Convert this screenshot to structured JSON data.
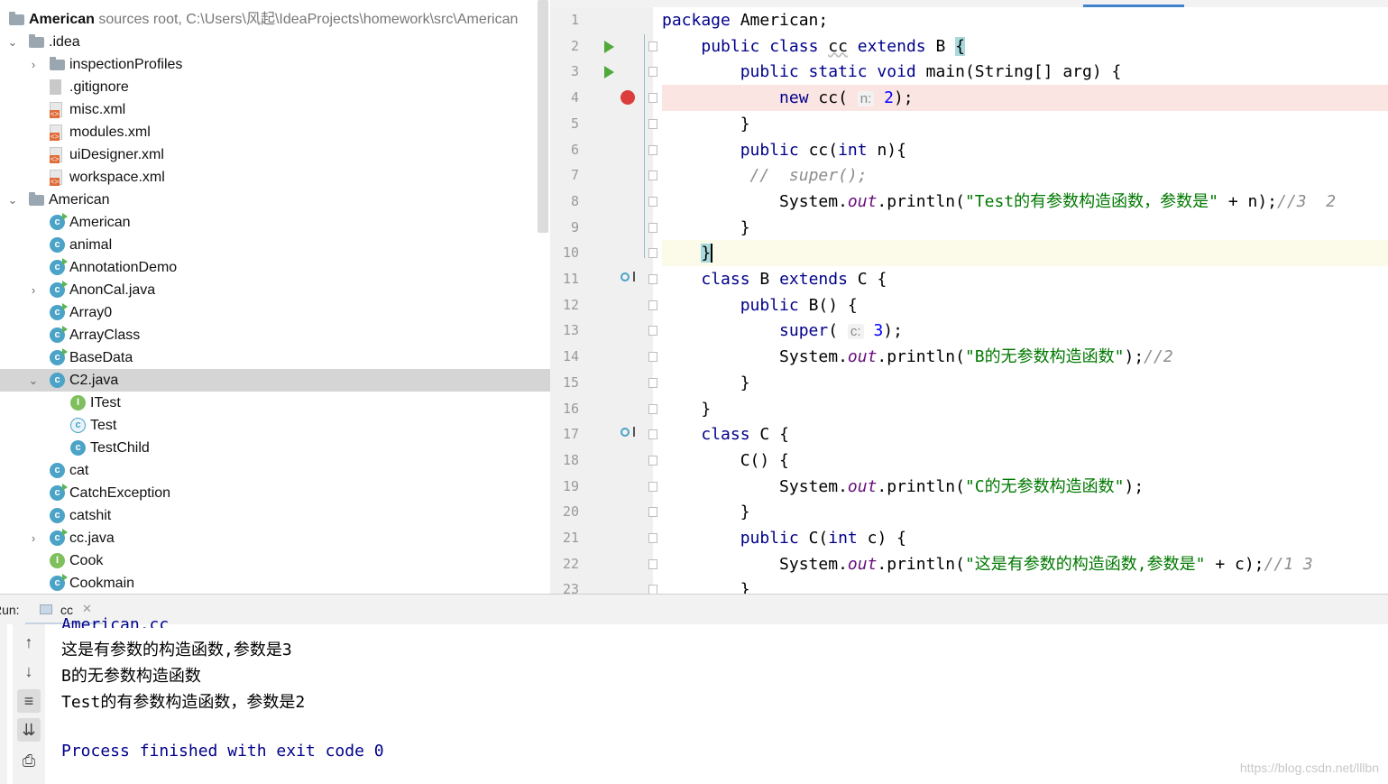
{
  "project_tree": {
    "root": {
      "name": "American",
      "detail": "sources root,  C:\\Users\\风起\\IdeaProjects\\homework\\src\\American"
    },
    "items": [
      {
        "label": ".idea",
        "kind": "folder",
        "depth": 0,
        "expanded": true
      },
      {
        "label": "inspectionProfiles",
        "kind": "folder",
        "depth": 1,
        "expanded": false
      },
      {
        "label": ".gitignore",
        "kind": "file",
        "depth": 1
      },
      {
        "label": "misc.xml",
        "kind": "xml",
        "depth": 1
      },
      {
        "label": "modules.xml",
        "kind": "xml",
        "depth": 1
      },
      {
        "label": "uiDesigner.xml",
        "kind": "xml",
        "depth": 1
      },
      {
        "label": "workspace.xml",
        "kind": "xml",
        "depth": 1
      },
      {
        "label": "American",
        "kind": "folder",
        "depth": 0,
        "expanded": true
      },
      {
        "label": "American",
        "kind": "class-main",
        "depth": 1
      },
      {
        "label": "animal",
        "kind": "class",
        "depth": 1
      },
      {
        "label": "AnnotationDemo",
        "kind": "class-main",
        "depth": 1
      },
      {
        "label": "AnonCal.java",
        "kind": "class-main",
        "depth": 1,
        "expanded": false
      },
      {
        "label": "Array0",
        "kind": "class-main",
        "depth": 1
      },
      {
        "label": "ArrayClass",
        "kind": "class-main",
        "depth": 1
      },
      {
        "label": "BaseData",
        "kind": "class-main",
        "depth": 1
      },
      {
        "label": "C2.java",
        "kind": "class",
        "depth": 1,
        "expanded": true,
        "selected": true
      },
      {
        "label": "ITest",
        "kind": "interface",
        "depth": 2
      },
      {
        "label": "Test",
        "kind": "class-outline",
        "depth": 2
      },
      {
        "label": "TestChild",
        "kind": "class",
        "depth": 2
      },
      {
        "label": "cat",
        "kind": "class",
        "depth": 1
      },
      {
        "label": "CatchException",
        "kind": "class-main",
        "depth": 1
      },
      {
        "label": "catshit",
        "kind": "class",
        "depth": 1
      },
      {
        "label": "cc.java",
        "kind": "class-main",
        "depth": 1,
        "expanded": false
      },
      {
        "label": "Cook",
        "kind": "interface",
        "depth": 1
      },
      {
        "label": "Cookmain",
        "kind": "class-main",
        "depth": 1
      }
    ]
  },
  "editor": {
    "lines": [
      {
        "n": "1",
        "parts": [
          [
            "kw",
            "package"
          ],
          [
            "t",
            " American;"
          ]
        ]
      },
      {
        "n": "2",
        "gutter": "run",
        "parts": [
          [
            "t",
            "    "
          ],
          [
            "kw",
            "public class "
          ],
          [
            "sq",
            "cc"
          ],
          [
            "kw",
            " extends "
          ],
          [
            "t",
            "B "
          ],
          [
            "bh",
            "{"
          ]
        ]
      },
      {
        "n": "3",
        "gutter": "run",
        "parts": [
          [
            "t",
            "        "
          ],
          [
            "kw",
            "public static void "
          ],
          [
            "t",
            "main(String[] arg) {"
          ]
        ]
      },
      {
        "n": "4",
        "gutter": "breakpoint",
        "highlight": "red",
        "parts": [
          [
            "t",
            "            "
          ],
          [
            "kw",
            "new "
          ],
          [
            "t",
            "cc( "
          ],
          [
            "hint",
            "n:"
          ],
          [
            "t",
            " "
          ],
          [
            "num",
            "2"
          ],
          [
            "t",
            ");"
          ]
        ]
      },
      {
        "n": "5",
        "parts": [
          [
            "t",
            "        }"
          ]
        ]
      },
      {
        "n": "6",
        "parts": [
          [
            "t",
            "        "
          ],
          [
            "kw",
            "public "
          ],
          [
            "t",
            "cc("
          ],
          [
            "kw",
            "int "
          ],
          [
            "t",
            "n){"
          ]
        ]
      },
      {
        "n": "7",
        "parts": [
          [
            "t",
            "         "
          ],
          [
            "cmt",
            "//  super();"
          ]
        ]
      },
      {
        "n": "8",
        "parts": [
          [
            "t",
            "            System."
          ],
          [
            "it",
            "out"
          ],
          [
            "t",
            ".println("
          ],
          [
            "str",
            "\"Test的有参数构造函数，参数是\""
          ],
          [
            "t",
            " + n);"
          ],
          [
            "cmt",
            "//3  2"
          ]
        ]
      },
      {
        "n": "9",
        "parts": [
          [
            "t",
            "        }"
          ]
        ]
      },
      {
        "n": "10",
        "highlight": "current",
        "parts": [
          [
            "t",
            "    "
          ],
          [
            "bh",
            "}"
          ],
          [
            "caret",
            ""
          ]
        ]
      },
      {
        "n": "11",
        "gutter": "override",
        "parts": [
          [
            "t",
            "    "
          ],
          [
            "kw",
            "class "
          ],
          [
            "t",
            "B "
          ],
          [
            "kw",
            "extends "
          ],
          [
            "t",
            "C {"
          ]
        ]
      },
      {
        "n": "12",
        "parts": [
          [
            "t",
            "        "
          ],
          [
            "kw",
            "public "
          ],
          [
            "t",
            "B() {"
          ]
        ]
      },
      {
        "n": "13",
        "parts": [
          [
            "t",
            "            "
          ],
          [
            "kw",
            "super"
          ],
          [
            "t",
            "( "
          ],
          [
            "hint",
            "c:"
          ],
          [
            "t",
            " "
          ],
          [
            "num",
            "3"
          ],
          [
            "t",
            ");"
          ]
        ]
      },
      {
        "n": "14",
        "parts": [
          [
            "t",
            "            System."
          ],
          [
            "it",
            "out"
          ],
          [
            "t",
            ".println("
          ],
          [
            "str",
            "\"B的无参数构造函数\""
          ],
          [
            "t",
            ");"
          ],
          [
            "cmt",
            "//2"
          ]
        ]
      },
      {
        "n": "15",
        "parts": [
          [
            "t",
            "        }"
          ]
        ]
      },
      {
        "n": "16",
        "parts": [
          [
            "t",
            "    }"
          ]
        ]
      },
      {
        "n": "17",
        "gutter": "override",
        "parts": [
          [
            "t",
            "    "
          ],
          [
            "kw",
            "class "
          ],
          [
            "t",
            "C {"
          ]
        ]
      },
      {
        "n": "18",
        "parts": [
          [
            "t",
            "        C() {"
          ]
        ]
      },
      {
        "n": "19",
        "parts": [
          [
            "t",
            "            System."
          ],
          [
            "it",
            "out"
          ],
          [
            "t",
            ".println("
          ],
          [
            "str",
            "\"C的无参数构造函数\""
          ],
          [
            "t",
            ");"
          ]
        ]
      },
      {
        "n": "20",
        "parts": [
          [
            "t",
            "        }"
          ]
        ]
      },
      {
        "n": "21",
        "parts": [
          [
            "t",
            "        "
          ],
          [
            "kw",
            "public "
          ],
          [
            "t",
            "C("
          ],
          [
            "kw",
            "int "
          ],
          [
            "t",
            "c) {"
          ]
        ]
      },
      {
        "n": "22",
        "parts": [
          [
            "t",
            "            System."
          ],
          [
            "it",
            "out"
          ],
          [
            "t",
            ".println("
          ],
          [
            "str",
            "\"这是有参数的构造函数,参数是\""
          ],
          [
            "t",
            " + c);"
          ],
          [
            "cmt",
            "//1 3"
          ]
        ]
      },
      {
        "n": "23",
        "parts": [
          [
            "t",
            "        }"
          ]
        ]
      }
    ]
  },
  "run_panel": {
    "label": "Run:",
    "tab": "cc",
    "cut_line": "American.cc",
    "output": [
      "这是有参数的构造函数,参数是3",
      "B的无参数构造函数",
      "Test的有参数构造函数，参数是2",
      "",
      "Process finished with exit code 0"
    ]
  },
  "watermark": "https://blog.csdn.net/lllbn"
}
